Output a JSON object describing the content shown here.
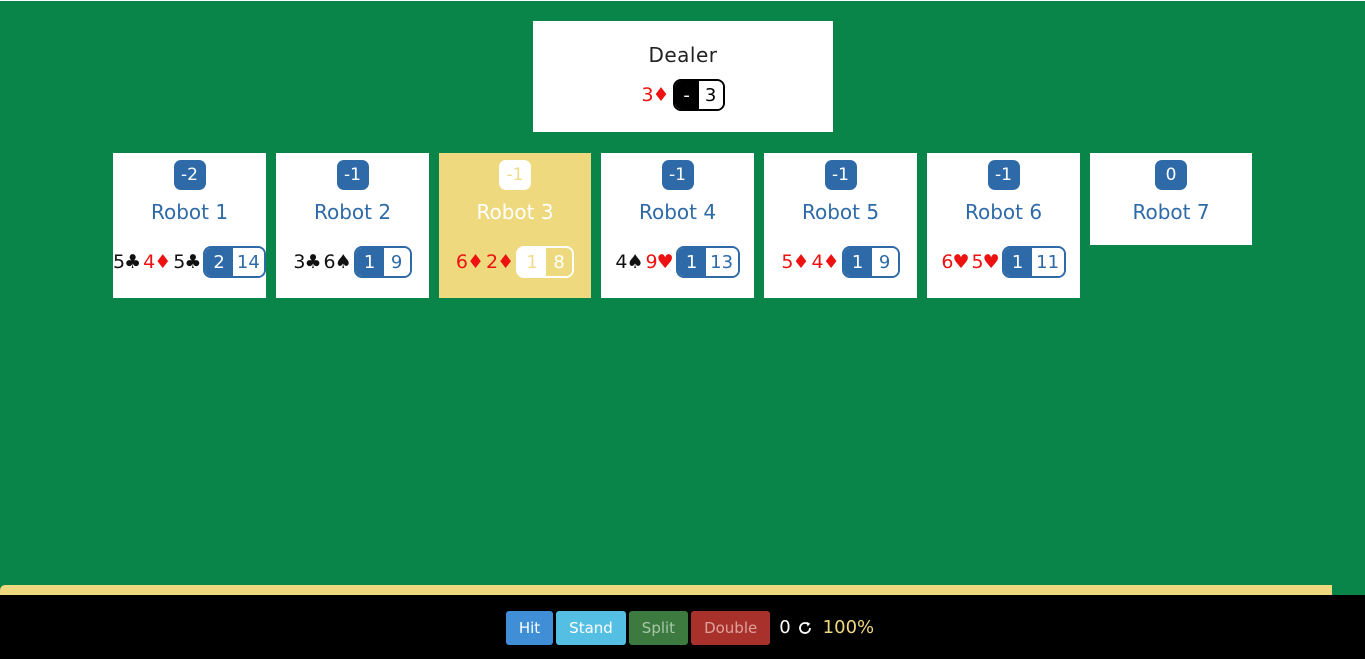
{
  "dealer": {
    "title": "Dealer",
    "cards": [
      {
        "text": "3♦",
        "color": "red"
      }
    ],
    "count_a": "-",
    "count_b": "3"
  },
  "players": [
    {
      "badge": "-2",
      "name": "Robot 1",
      "cards": [
        {
          "text": "5♣",
          "color": "black"
        },
        {
          "text": "4♦",
          "color": "red"
        },
        {
          "text": "5♣",
          "color": "black"
        }
      ],
      "a": "2",
      "b": "14",
      "active": false
    },
    {
      "badge": "-1",
      "name": "Robot 2",
      "cards": [
        {
          "text": "3♣",
          "color": "black"
        },
        {
          "text": "6♠",
          "color": "black"
        }
      ],
      "a": "1",
      "b": "9",
      "active": false
    },
    {
      "badge": "-1",
      "name": "Robot 3",
      "cards": [
        {
          "text": "6♦",
          "color": "red"
        },
        {
          "text": "2♦",
          "color": "red"
        }
      ],
      "a": "1",
      "b": "8",
      "active": true
    },
    {
      "badge": "-1",
      "name": "Robot 4",
      "cards": [
        {
          "text": "4♠",
          "color": "black"
        },
        {
          "text": "9♥",
          "color": "red"
        }
      ],
      "a": "1",
      "b": "13",
      "active": false
    },
    {
      "badge": "-1",
      "name": "Robot 5",
      "cards": [
        {
          "text": "5♦",
          "color": "red"
        },
        {
          "text": "4♦",
          "color": "red"
        }
      ],
      "a": "1",
      "b": "9",
      "active": false
    },
    {
      "badge": "-1",
      "name": "Robot 6",
      "cards": [
        {
          "text": "6♥",
          "color": "red"
        },
        {
          "text": "5♥",
          "color": "red"
        }
      ],
      "a": "1",
      "b": "11",
      "active": false
    },
    {
      "badge": "0",
      "name": "Robot 7",
      "cards": [],
      "a": "",
      "b": "",
      "active": false
    }
  ],
  "progress": 0.976,
  "controls": {
    "hit": "Hit",
    "stand": "Stand",
    "split": "Split",
    "double": "Double",
    "score": "0",
    "refresh_icon": "refresh-icon",
    "percent": "100%"
  },
  "colors": {
    "felt": "#09854a",
    "accent": "#eed97e",
    "blue": "#2f6aa8"
  }
}
